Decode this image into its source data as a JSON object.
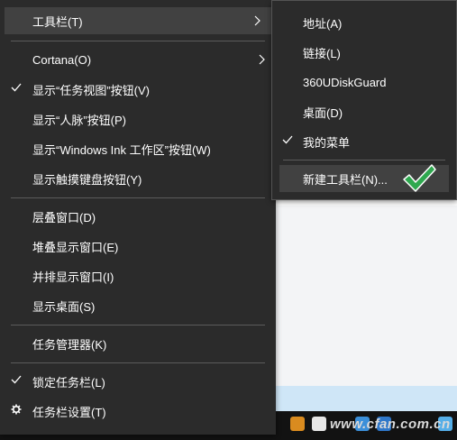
{
  "main_menu": {
    "items": [
      {
        "label": "工具栏(T)",
        "checked": false,
        "submenu": true,
        "hover": true
      },
      {
        "label": "Cortana(O)",
        "checked": false,
        "submenu": true
      },
      {
        "label": "显示“任务视图”按钮(V)",
        "checked": true
      },
      {
        "label": "显示“人脉”按钮(P)",
        "checked": false
      },
      {
        "label": "显示“Windows Ink 工作区”按钮(W)",
        "checked": false
      },
      {
        "label": "显示触摸键盘按钮(Y)",
        "checked": false
      },
      {
        "label": "层叠窗口(D)",
        "checked": false
      },
      {
        "label": "堆叠显示窗口(E)",
        "checked": false
      },
      {
        "label": "并排显示窗口(I)",
        "checked": false
      },
      {
        "label": "显示桌面(S)",
        "checked": false
      },
      {
        "label": "任务管理器(K)",
        "checked": false
      },
      {
        "label": "锁定任务栏(L)",
        "checked": true
      },
      {
        "label": "任务栏设置(T)",
        "checked": false,
        "icon": "gear-icon"
      }
    ]
  },
  "sub_menu": {
    "items": [
      {
        "label": "地址(A)",
        "checked": false
      },
      {
        "label": "链接(L)",
        "checked": false
      },
      {
        "label": "360UDiskGuard",
        "checked": false
      },
      {
        "label": "桌面(D)",
        "checked": false
      },
      {
        "label": "我的菜单",
        "checked": true
      },
      {
        "label": "新建工具栏(N)...",
        "checked": false,
        "hover": true
      }
    ]
  },
  "watermark": "www.cfan.com.cn",
  "colors": {
    "menu_bg": "#2b2b2b",
    "hover_bg": "#414141",
    "separator": "#5b5b5b",
    "check_green": "#2fa84f",
    "taskbar": "#121212"
  }
}
